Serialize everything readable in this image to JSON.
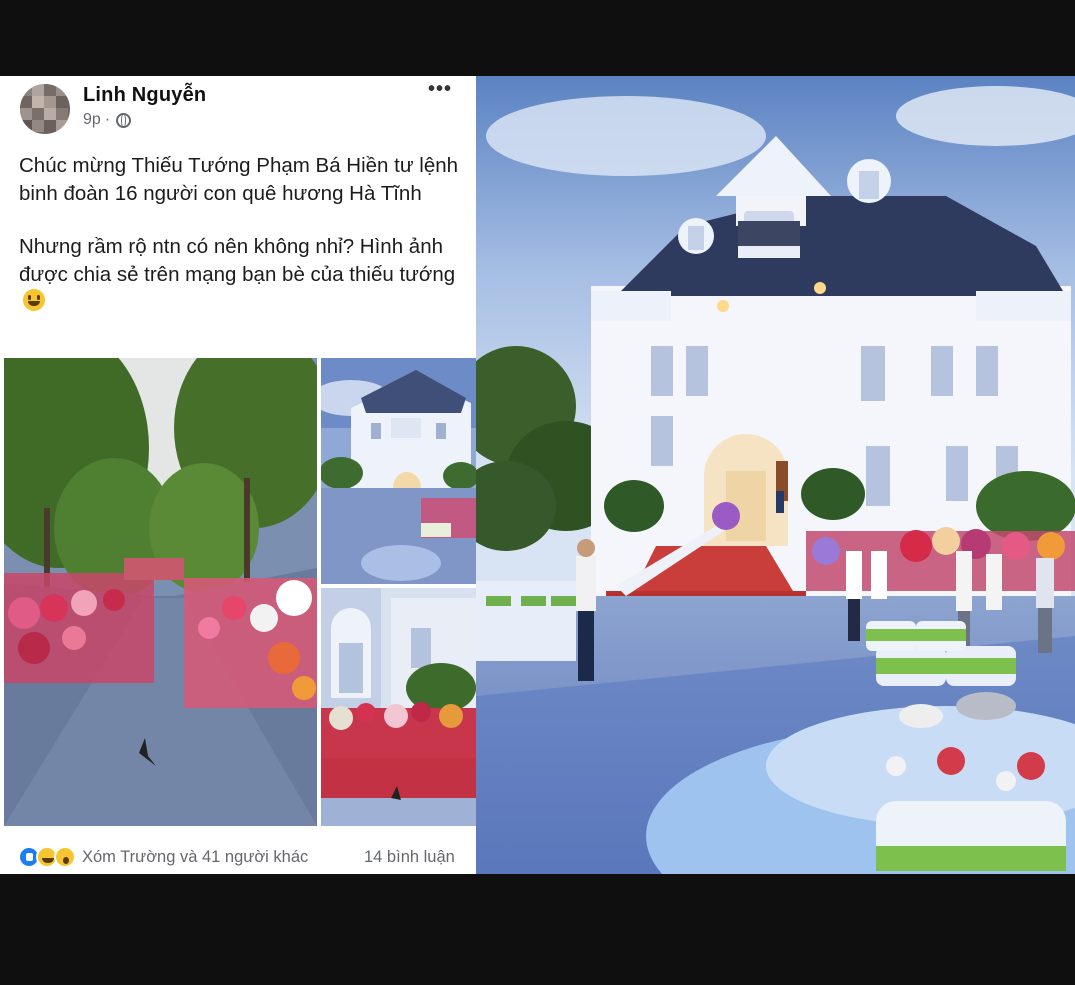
{
  "post": {
    "author": "Linh Nguyễn",
    "time": "9p",
    "separator": "·",
    "menu": "•••",
    "paragraph1": "Chúc mừng Thiếu Tướng Phạm Bá Hiền tư lệnh binh đoàn 16 người con quê hương Hà Tĩnh",
    "paragraph2": "Nhưng rầm rộ ntn có nên không nhỉ? Hình ảnh được chia sẻ trên mạng bạn bè của thiếu tướng"
  },
  "footer": {
    "reactions_text": "Xóm Trường và 41 người khác",
    "comments_text": "14 bình luận",
    "reaction_icons": [
      "like-icon",
      "haha-icon",
      "wow-icon"
    ]
  },
  "colors": {
    "reaction_like": "#1d7df2",
    "reaction_emoji": "#f7c531",
    "meta_text": "#65676b"
  }
}
